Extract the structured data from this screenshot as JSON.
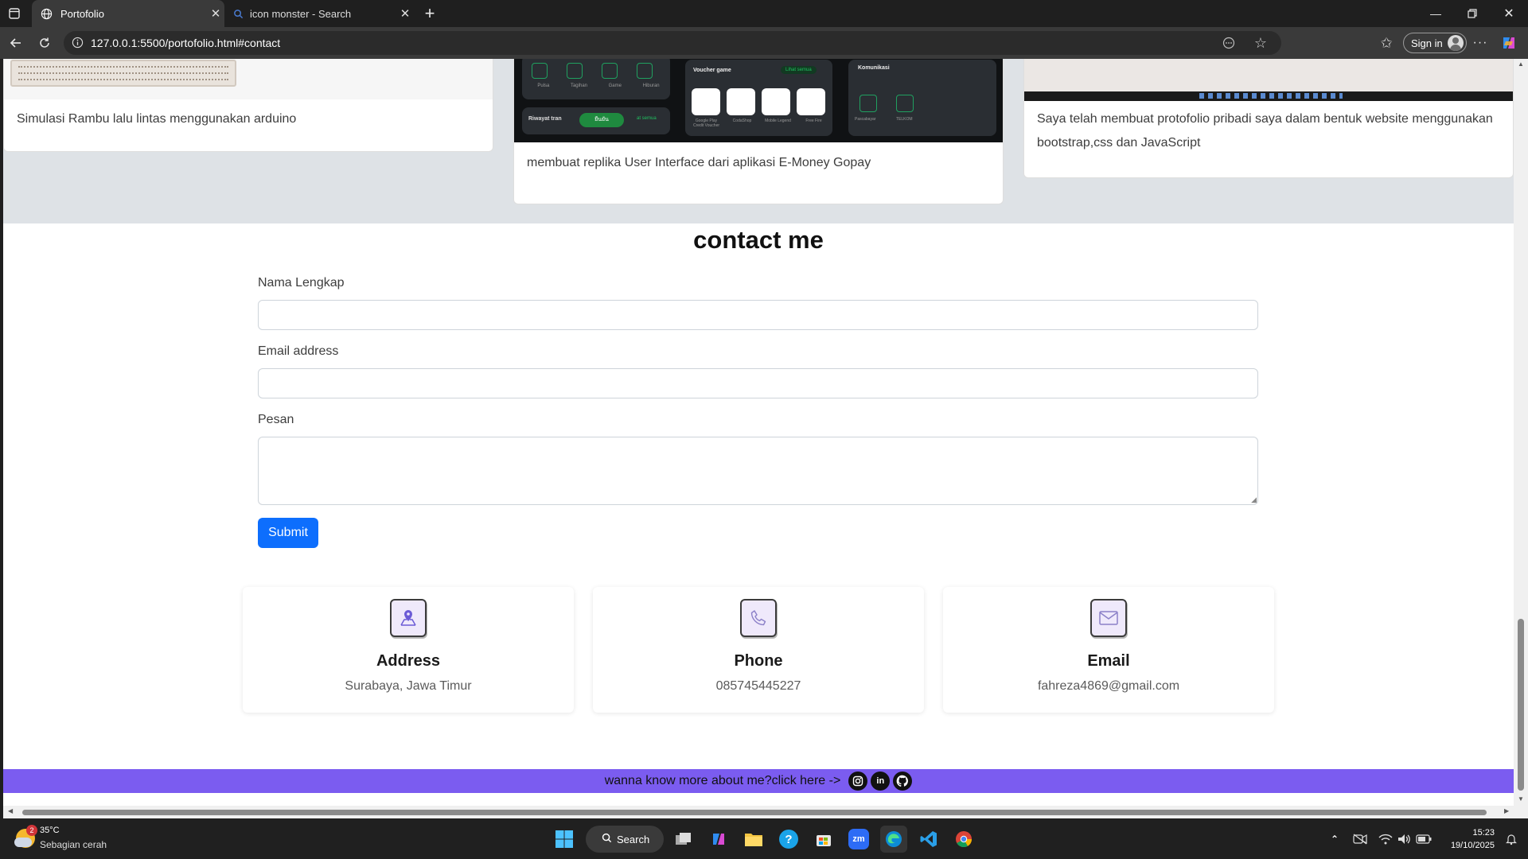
{
  "browser": {
    "tabs": [
      {
        "title": "Portofolio",
        "active": true,
        "icon": "globe-icon"
      },
      {
        "title": "icon monster - Search",
        "active": false,
        "icon": "search-icon"
      }
    ],
    "url": "127.0.0.1:5500/portofolio.html#contact",
    "sign_in": "Sign in"
  },
  "portfolio": {
    "cards": [
      {
        "caption": "Simulasi Rambu lalu lintas menggunakan arduino"
      },
      {
        "caption": "membuat replika User Interface dari aplikasi E-Money Gopay",
        "mock": {
          "menu_items": [
            "Pulsa",
            "Tagihan",
            "Game",
            "Hiburan"
          ],
          "voucher_title": "Voucher game",
          "voucher_link": "Lihat semua",
          "vouchers": [
            "Google Play Credit Voucher",
            "CodaShop",
            "Mobile Legend",
            "Free Fire"
          ],
          "comm_title": "Komunikasi",
          "comm_items": [
            "Pascabayar",
            "TELKOM"
          ],
          "history_title": "Riwayat tran",
          "history_link": "at semua",
          "history_btn": "ยืนยัน"
        }
      },
      {
        "caption": "Saya telah membuat protofolio pribadi saya dalam bentuk website menggunakan bootstrap,css dan JavaScript"
      }
    ]
  },
  "contact": {
    "title": "contact me",
    "fields": {
      "name_label": "Nama Lengkap",
      "email_label": "Email address",
      "message_label": "Pesan"
    },
    "submit_label": "Submit",
    "info": [
      {
        "title": "Address",
        "value": "Surabaya, Jawa Timur",
        "icon": "map-pin-icon"
      },
      {
        "title": "Phone",
        "value": "085745445227",
        "icon": "phone-icon"
      },
      {
        "title": "Email",
        "value": "fahreza4869@gmail.com",
        "icon": "mail-icon"
      }
    ]
  },
  "footer": {
    "text": "wanna know more about me?click here ->",
    "socials": [
      "instagram-icon",
      "linkedin-icon",
      "github-icon"
    ],
    "linkedin_label": "in",
    "color": "#7b5cf0"
  },
  "taskbar": {
    "weather_temp": "35°C",
    "weather_desc": "Sebagian cerah",
    "weather_badge": "2",
    "search_label": "Search",
    "zoom_label": "zm",
    "time": "15:23",
    "date": "19/10/2025"
  }
}
